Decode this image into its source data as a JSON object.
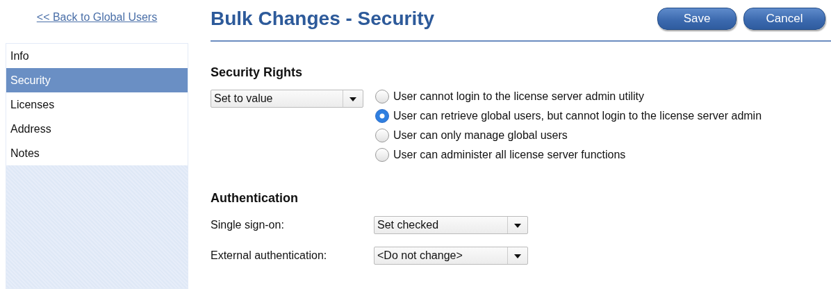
{
  "back_link": "<< Back to Global Users",
  "sidebar": {
    "items": [
      {
        "label": "Info",
        "selected": false
      },
      {
        "label": "Security",
        "selected": true
      },
      {
        "label": "Licenses",
        "selected": false
      },
      {
        "label": "Address",
        "selected": false
      },
      {
        "label": "Notes",
        "selected": false
      }
    ]
  },
  "title": "Bulk Changes - Security",
  "buttons": [
    "Save",
    "Cancel"
  ],
  "security_rights": {
    "heading": "Security Rights",
    "mode": {
      "value": "Set to value"
    },
    "options": [
      {
        "label": "User cannot login to the license server admin utility",
        "selected": false
      },
      {
        "label": "User can retrieve global users, but cannot login to the license server admin",
        "selected": true
      },
      {
        "label": "User can only manage global users",
        "selected": false
      },
      {
        "label": "User can administer all license server functions",
        "selected": false
      }
    ]
  },
  "authentication": {
    "heading": "Authentication",
    "fields": [
      {
        "label": "Single sign-on:",
        "value": "Set checked"
      },
      {
        "label": "External authentication:",
        "value": "<Do not change>"
      }
    ]
  }
}
